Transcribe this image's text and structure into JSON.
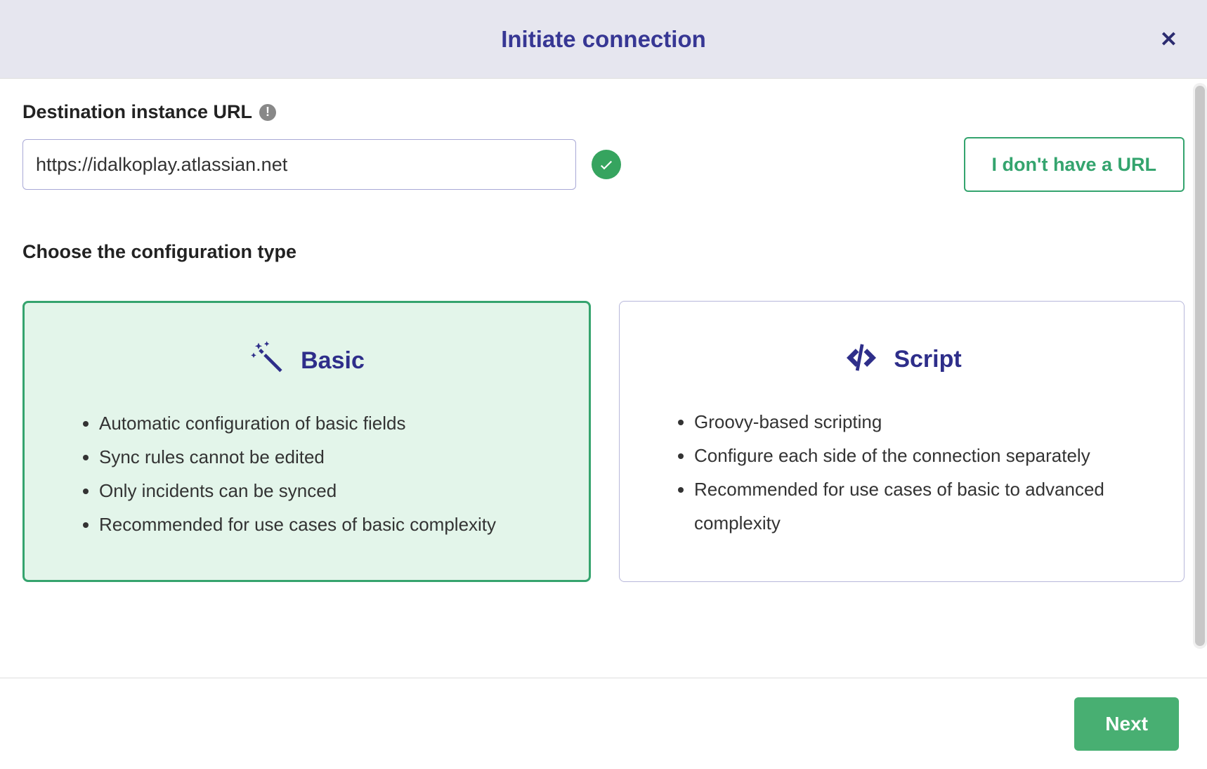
{
  "modal": {
    "title": "Initiate connection"
  },
  "url_section": {
    "label": "Destination instance URL",
    "value": "https://idalkoplay.atlassian.net",
    "no_url_button": "I don't have a URL"
  },
  "config_section": {
    "label": "Choose the configuration type",
    "options": [
      {
        "id": "basic",
        "title": "Basic",
        "selected": true,
        "features": [
          "Automatic configuration of basic fields",
          "Sync rules cannot be edited",
          "Only incidents can be synced",
          "Recommended for use cases of basic complexity"
        ]
      },
      {
        "id": "script",
        "title": "Script",
        "selected": false,
        "features": [
          "Groovy-based scripting",
          "Configure each side of the connection separately",
          "Recommended for use cases of basic to advanced complexity"
        ]
      }
    ]
  },
  "footer": {
    "next_button": "Next"
  }
}
